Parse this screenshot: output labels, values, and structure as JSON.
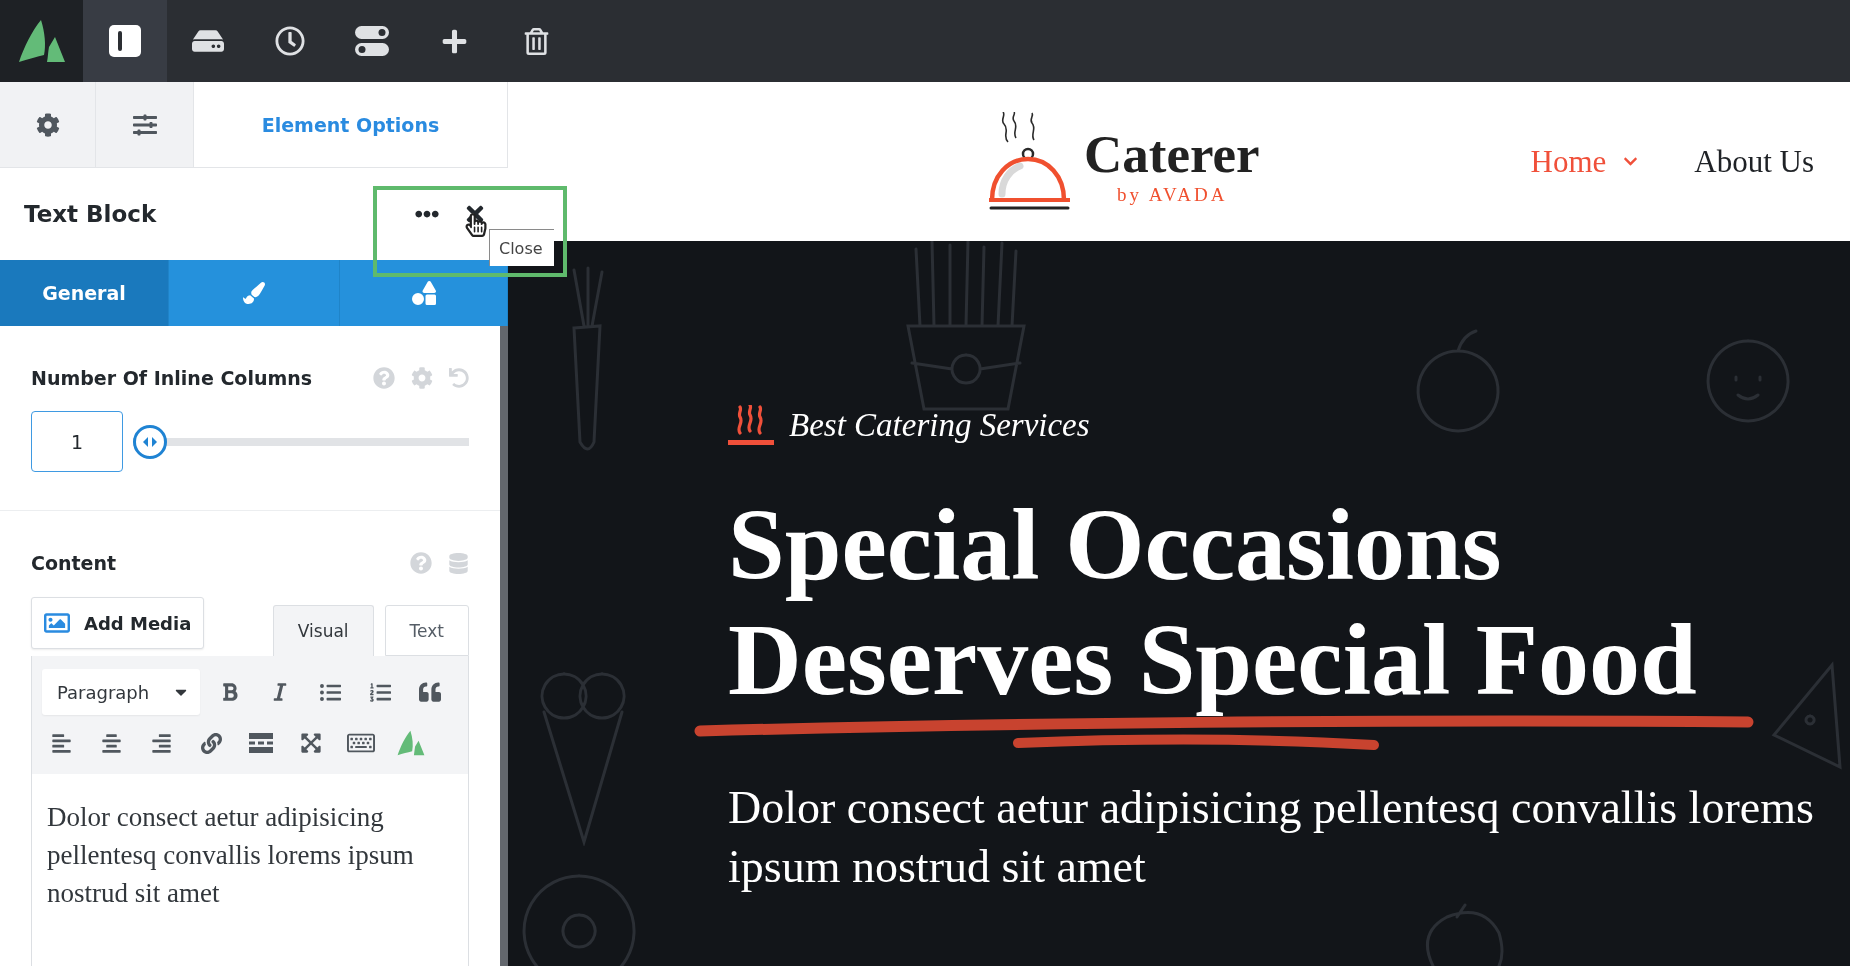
{
  "toolbar": {
    "items": [
      {
        "kind": "logo",
        "selected": false
      },
      {
        "kind": "sidebar",
        "selected": true
      },
      {
        "kind": "library",
        "selected": false
      },
      {
        "kind": "history",
        "selected": false
      },
      {
        "kind": "toggles",
        "selected": false
      },
      {
        "kind": "add",
        "selected": false
      },
      {
        "kind": "delete",
        "selected": false
      }
    ]
  },
  "panel": {
    "tabs": [
      {
        "kind": "settings",
        "selected": false
      },
      {
        "kind": "options",
        "selected": false
      },
      {
        "kind": "label",
        "label": "Element Options",
        "selected": true
      }
    ],
    "title": "Text Block",
    "close_tooltip": "Close",
    "sub_tabs": [
      {
        "kind": "label",
        "label": "General",
        "selected": true
      },
      {
        "kind": "design",
        "selected": false
      },
      {
        "kind": "extras",
        "selected": false
      }
    ],
    "columns_field": {
      "label": "Number Of Inline Columns",
      "value": "1",
      "level": 0
    },
    "content_field": {
      "label": "Content",
      "add_media": "Add Media",
      "modes": [
        {
          "label": "Visual",
          "selected": true
        },
        {
          "label": "Text",
          "selected": false
        }
      ],
      "format": "Paragraph",
      "text": "Dolor consect aetur adipisicing pellentesq convallis lorems ipsum nostrud sit amet"
    }
  },
  "preview": {
    "logo": {
      "name": "Caterer",
      "tagline": "by AVADA"
    },
    "nav": [
      {
        "label": "Home",
        "selected": true,
        "dropdown": true
      },
      {
        "label": "About Us",
        "selected": false,
        "dropdown": false
      }
    ],
    "hero": {
      "eyebrow": "Best Catering Services",
      "heading": "Special Occasions Deserves Special Food",
      "text": "Dolor consect aetur adipisicing pellentesq convallis lorems ipsum nostrud sit amet"
    }
  }
}
